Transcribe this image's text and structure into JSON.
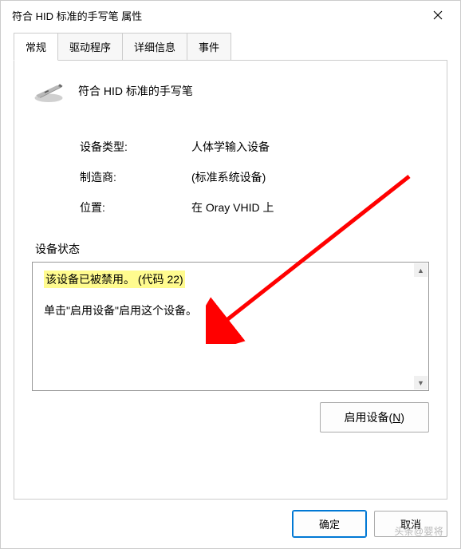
{
  "window": {
    "title": "符合 HID 标准的手写笔 属性"
  },
  "tabs": {
    "general": "常规",
    "driver": "驱动程序",
    "details": "详细信息",
    "events": "事件"
  },
  "device": {
    "name": "符合 HID 标准的手写笔"
  },
  "info": {
    "type_label": "设备类型:",
    "type_value": "人体学输入设备",
    "manufacturer_label": "制造商:",
    "manufacturer_value": "(标准系统设备)",
    "location_label": "位置:",
    "location_value": "在 Oray VHID 上"
  },
  "status": {
    "title": "设备状态",
    "line1": "该设备已被禁用。 (代码 22)",
    "line2": "单击\"启用设备\"启用这个设备。"
  },
  "buttons": {
    "enable_prefix": "启用设备(",
    "enable_key": "N",
    "enable_suffix": ")",
    "ok": "确定",
    "cancel": "取消"
  },
  "watermark": "头条@婴将"
}
